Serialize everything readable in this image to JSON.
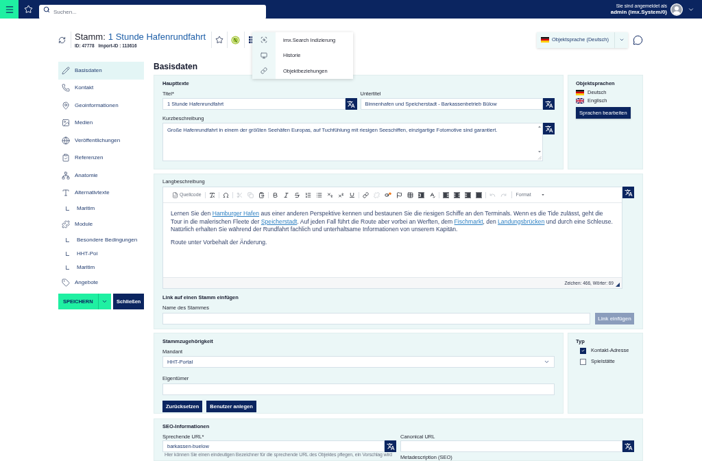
{
  "top_bar": {
    "search": {
      "placeholder": "Suchen..."
    },
    "user": {
      "caption": "Sie sind angemeldet als",
      "name": "admin (imx.System/0)"
    }
  },
  "header": {
    "title_prefix": "Stamm:",
    "title": "1 Stunde Hafenrundfahrt",
    "id": "ID: 47778",
    "import_id": "Import-ID : 113616"
  },
  "actions_menu": {
    "items": [
      {
        "kind": "search",
        "label": "imx.Search Indizierung"
      },
      {
        "kind": "history",
        "label": "Historie"
      },
      {
        "kind": "relations",
        "label": "Objektbeziehungen"
      }
    ]
  },
  "language_select": {
    "kind": "de",
    "value": "Objektsprache (Deutsch)"
  },
  "sidebar": {
    "items": [
      {
        "kind": "pencil",
        "label": "Basisdaten",
        "selected": true
      },
      {
        "kind": "phone",
        "label": "Kontakt",
        "selected": false
      },
      {
        "kind": "pin",
        "label": "Geoinformationen",
        "selected": false
      },
      {
        "kind": "image",
        "label": "Medien",
        "selected": false
      },
      {
        "kind": "globe",
        "label": "Veröffentlichungen",
        "selected": false
      },
      {
        "kind": "clipboard",
        "label": "Referenzen",
        "selected": false
      },
      {
        "kind": "hierarchy",
        "label": "Anatomie",
        "selected": false
      },
      {
        "kind": "text",
        "label": "Alternativtexte",
        "selected": false,
        "children": [
          {
            "label": "Maritim",
            "selected": false
          }
        ]
      },
      {
        "kind": "puzzle",
        "label": "Module",
        "selected": false,
        "children": [
          {
            "label": "Besondere Bedingungen",
            "selected": false
          },
          {
            "label": "HHT-Poi",
            "selected": false
          },
          {
            "label": "Maritim",
            "selected": false
          }
        ]
      },
      {
        "kind": "tag",
        "label": "Angebote",
        "selected": false
      }
    ],
    "save_label": "SPEICHERN",
    "close_label": "Schließen"
  },
  "page_title": "Basisdaten",
  "main_texts": {
    "title": "Haupttexte",
    "fields": [
      {
        "label": "Titel*",
        "value": "1 Stunde Hafenrundfahrt"
      },
      {
        "label": "Untertitel",
        "value": "Binnenhafen und Speicherstadt - Barkassenbetrieb Bülow"
      }
    ],
    "short_description": {
      "label": "Kurzbeschreibung",
      "value": "Große Hafenrundfahrt in einem der größten Seehäfen Europas, auf Tuchfühlung mit riesigen Seeschiffen, einzigartige Fotomotive sind garantiert."
    }
  },
  "object_languages": {
    "title": "Objektsprachen",
    "languages": [
      {
        "kind": "de",
        "label": "Deutsch"
      },
      {
        "kind": "en",
        "label": "Englisch"
      }
    ],
    "edit_button": "Sprachen bearbeiten"
  },
  "long_description": {
    "label": "Langbeschreibung",
    "toolbar": {
      "groups": [
        {
          "buttons": [
            {
              "kind": "source",
              "label": "Quellcode",
              "disabled": false
            }
          ]
        },
        {
          "buttons": [
            {
              "kind": "remove_format",
              "disabled": false
            }
          ]
        },
        {
          "buttons": [
            {
              "kind": "special_char",
              "disabled": false
            }
          ]
        },
        {
          "buttons": [
            {
              "kind": "cut",
              "disabled": true
            },
            {
              "kind": "copy",
              "disabled": true
            },
            {
              "kind": "paste",
              "disabled": false
            }
          ]
        },
        {
          "buttons": [
            {
              "kind": "bold",
              "disabled": false
            },
            {
              "kind": "italic",
              "disabled": false
            },
            {
              "kind": "strike",
              "disabled": false
            },
            {
              "kind": "numbered_list",
              "disabled": false
            },
            {
              "kind": "bulleted_list",
              "disabled": false
            },
            {
              "kind": "subscript",
              "disabled": false
            },
            {
              "kind": "superscript",
              "disabled": false
            },
            {
              "kind": "underline",
              "disabled": false
            }
          ]
        },
        {
          "buttons": [
            {
              "kind": "link",
              "disabled": false
            },
            {
              "kind": "unlink",
              "disabled": true
            },
            {
              "kind": "object_link",
              "disabled": false
            },
            {
              "kind": "anchor",
              "disabled": false
            },
            {
              "kind": "table",
              "disabled": false
            },
            {
              "kind": "indent",
              "disabled": false
            },
            {
              "kind": "spellcheck",
              "disabled": false
            }
          ]
        },
        {
          "buttons": [
            {
              "kind": "align_left",
              "disabled": false
            },
            {
              "kind": "align_center",
              "disabled": false
            },
            {
              "kind": "align_right",
              "disabled": false
            },
            {
              "kind": "justify",
              "disabled": false
            }
          ]
        },
        {
          "buttons": [
            {
              "kind": "undo",
              "disabled": true
            },
            {
              "kind": "redo",
              "disabled": true
            }
          ]
        }
      ],
      "format_label": "Format"
    },
    "paragraphs": [
      [
        {
          "kind": "text",
          "text": "Lernen Sie den "
        },
        {
          "kind": "link",
          "text": "Hamburger Hafen"
        },
        {
          "kind": "text",
          "text": " aus einer anderen Perspektive kennen und bestaunen Sie die riesigen Schiffe an den Terminals. Wenn es die Tide zulässt, geht die Tour in die malerischen Fleete der "
        },
        {
          "kind": "link",
          "text": "Speicherstadt"
        },
        {
          "kind": "text",
          "text": ". Auf jeden Fall führt die Route aber vorbei an Werften, dem "
        },
        {
          "kind": "link",
          "text": "Fischmarkt"
        },
        {
          "kind": "text",
          "text": ", den "
        },
        {
          "kind": "link",
          "text": "Landungsbrücken"
        },
        {
          "kind": "text",
          "text": " und durch eine Schleuse. Natürlich erhalten Sie während der Rundfahrt fachlich und unterhaltsame Informationen von unserem Kapitän."
        }
      ],
      [
        {
          "kind": "text",
          "text": "Route unter Vorbehalt der Änderung."
        }
      ]
    ],
    "counter": "Zeichen: 466, Wörter: 69"
  },
  "stamm_link": {
    "title": "Link auf einen Stamm einfügen",
    "label": "Name des Stammes",
    "button": {
      "label": "Link einfügen",
      "disabled": true
    }
  },
  "stamm_membership": {
    "title": "Stammzugehörigkeit",
    "client": {
      "label": "Mandant",
      "value": "HHT-Portal"
    },
    "owner": {
      "label": "Eigentümer"
    },
    "buttons": [
      "Zurücksetzen",
      "Benutzer anlegen"
    ]
  },
  "type_panel": {
    "title": "Typ",
    "options": [
      {
        "label": "Kontakt-Adresse",
        "checked": true
      },
      {
        "label": "Spielstätte",
        "checked": false
      }
    ]
  },
  "seo": {
    "title": "SEO-Informationen",
    "slug": {
      "label": "Sprechende URL*",
      "value": "barkassen-buelow",
      "help": "Hier können Sie einen eindeutigen Bezeichner für die sprechende URL des Objektes pflegen, ein Vorschlag wird"
    },
    "canonical": {
      "label": "Canonical URL"
    },
    "meta_description": {
      "label": "Metadescription (SEO)"
    }
  }
}
